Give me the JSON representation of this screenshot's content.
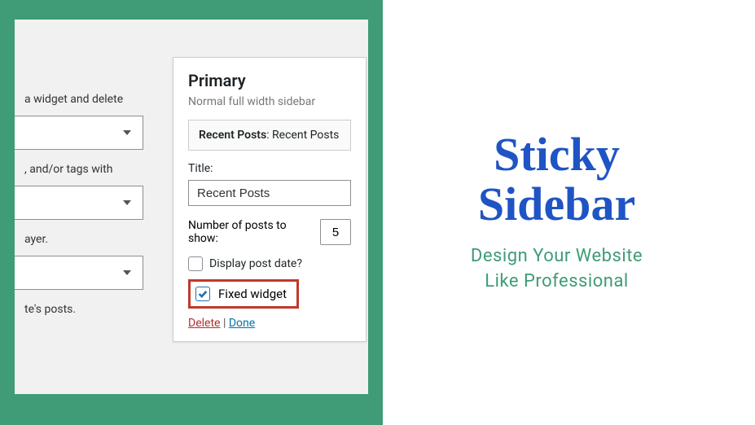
{
  "leftColumn": {
    "hint1": "a widget and delete",
    "hint2": ", and/or tags with",
    "hint3": "ayer.",
    "hint4": "te's posts."
  },
  "widget": {
    "mainTitle": "Primary",
    "subtitle": "Normal full width sidebar",
    "headerBold": "Recent Posts",
    "headerRest": ": Recent Posts",
    "titleLabel": "Title:",
    "titleValue": "Recent Posts",
    "numLabel": "Number of posts to show:",
    "numValue": "5",
    "displayDateLabel": "Display post date?",
    "fixedWidgetLabel": "Fixed widget",
    "deleteLabel": "Delete",
    "doneLabel": "Done"
  },
  "promo": {
    "headline1": "Sticky",
    "headline2": "Sidebar",
    "tag1": "Design Your Website",
    "tag2": "Like Professional"
  }
}
